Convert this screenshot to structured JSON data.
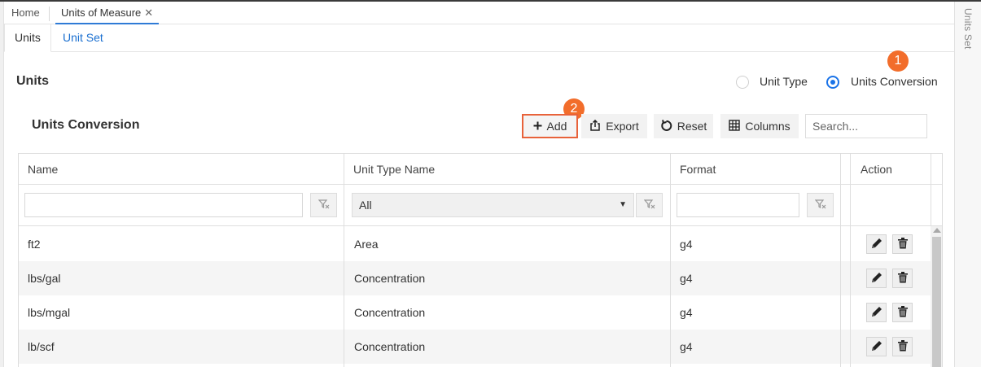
{
  "nav": {
    "home_label": "Home",
    "active_tab_label": "Units of Measure",
    "close_glyph": "✕"
  },
  "sub_tabs": {
    "units": "Units",
    "unit_set": "Unit Set"
  },
  "side_panel": {
    "label": "Units Set"
  },
  "page": {
    "title": "Units"
  },
  "mode": {
    "options": [
      "Unit Type",
      "Units Conversion"
    ],
    "selected": "Units Conversion"
  },
  "callouts": {
    "first": "1",
    "second": "2"
  },
  "toolbar": {
    "title": "Units Conversion",
    "add_label": "Add",
    "export_label": "Export",
    "reset_label": "Reset",
    "columns_label": "Columns",
    "search_placeholder": "Search..."
  },
  "grid": {
    "columns": [
      "Name",
      "Unit Type Name",
      "Format",
      "Action"
    ],
    "filters": {
      "unit_type_selected": "All"
    },
    "rows": [
      {
        "name": "ft2",
        "unit_type": "Area",
        "format": "g4"
      },
      {
        "name": "lbs/gal",
        "unit_type": "Concentration",
        "format": "g4"
      },
      {
        "name": "lbs/mgal",
        "unit_type": "Concentration",
        "format": "g4"
      },
      {
        "name": "lb/scf",
        "unit_type": "Concentration",
        "format": "g4"
      }
    ]
  },
  "icons": {
    "add": "plus-icon",
    "export": "export-icon",
    "reset": "reset-icon",
    "columns": "columns-grid-icon",
    "filter": "filter-clear-icon",
    "edit": "pencil-icon",
    "delete": "trash-icon"
  },
  "colors": {
    "accent_blue": "#1a73e8",
    "link_blue": "#1a6fd0",
    "callout_orange": "#f26d2b",
    "highlight_border": "#e8623a"
  }
}
